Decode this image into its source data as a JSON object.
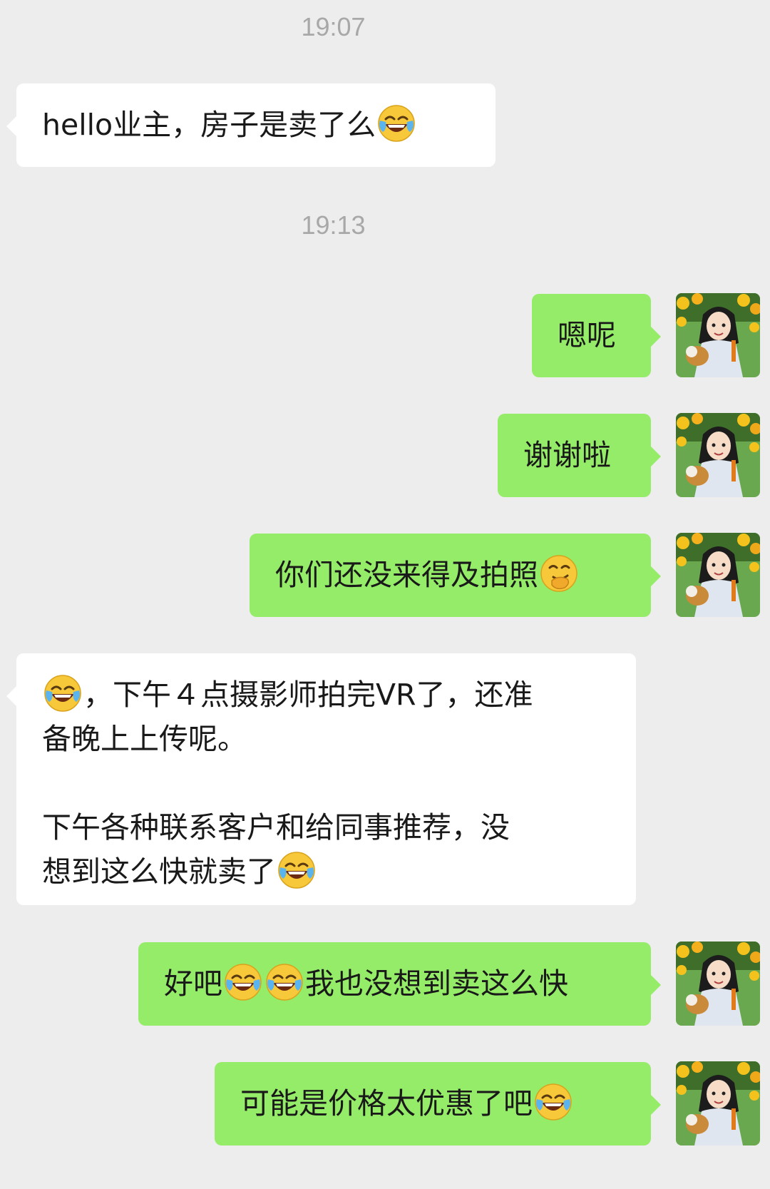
{
  "chat": {
    "messages": [
      {
        "type": "time",
        "text": "19:07"
      },
      {
        "type": "msg",
        "side": "left",
        "parts": [
          {
            "t": "hello业主，房子是卖了么"
          },
          {
            "e": "tears-of-joy"
          }
        ]
      },
      {
        "type": "time",
        "text": "19:13"
      },
      {
        "type": "msg",
        "side": "right",
        "parts": [
          {
            "t": "嗯呢"
          }
        ]
      },
      {
        "type": "msg",
        "side": "right",
        "parts": [
          {
            "t": "谢谢啦"
          }
        ]
      },
      {
        "type": "msg",
        "side": "right",
        "parts": [
          {
            "t": "你们还没来得及拍照"
          },
          {
            "e": "face-with-hand-over-mouth"
          }
        ]
      },
      {
        "type": "msg",
        "side": "left",
        "parts": [
          {
            "e": "tears-of-joy"
          },
          {
            "t": "，下午４点摄影师拍完VR了，还准\n备晚上上传呢。\n\n下午各种联系客户和给同事推荐，没\n想到这么快就卖了"
          },
          {
            "e": "tears-of-joy"
          }
        ]
      },
      {
        "type": "msg",
        "side": "right",
        "parts": [
          {
            "t": "好吧"
          },
          {
            "e": "tears-of-joy"
          },
          {
            "e": "tears-of-joy"
          },
          {
            "t": "我也没想到卖这么快"
          }
        ]
      },
      {
        "type": "msg",
        "side": "right",
        "parts": [
          {
            "t": "可能是价格太优惠了吧"
          },
          {
            "e": "tears-of-joy"
          }
        ]
      }
    ]
  },
  "colors": {
    "background": "#ededed",
    "bubble_left": "#ffffff",
    "bubble_right": "#95ec69",
    "time_text": "#a8a8a8"
  },
  "icons": {
    "avatar": "avatar-girl-sunflowers-icon",
    "emoji_laugh": "tears-of-joy-emoji-icon",
    "emoji_oops": "face-with-hand-over-mouth-emoji-icon"
  }
}
